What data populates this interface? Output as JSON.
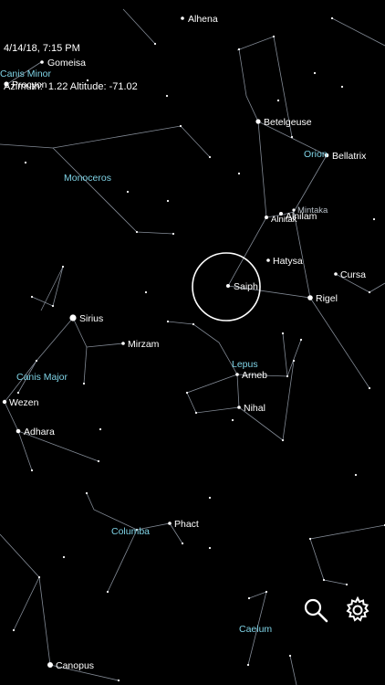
{
  "hud": {
    "datetime": "4/14/18, 7:15 PM",
    "position": "Azimuth:  1.22 Altitude: -71.02"
  },
  "constellations": [
    "Canis Minor",
    "Monoceros",
    "Orion",
    "Canis Major",
    "Lepus",
    "Columba",
    "Caelum"
  ],
  "stars": [
    "Alhena",
    "Gomeisa",
    "Procyon",
    "Betelgeuse",
    "Bellatrix",
    "Mintaka",
    "Alnilam",
    "Alnitak",
    "Hatysa",
    "Cursa",
    "Saiph",
    "Rigel",
    "Sirius",
    "Mirzam",
    "Arneb",
    "Wezen",
    "Nihal",
    "Adhara",
    "Phact",
    "Canopus"
  ],
  "toolbar": {
    "search_icon": "search-icon",
    "settings_icon": "gear-icon"
  },
  "colors": {
    "constellation_label": "#7fd3e6",
    "star_label": "#ffffff",
    "line": "#9aa3b0",
    "reticle": "#ffffff"
  }
}
